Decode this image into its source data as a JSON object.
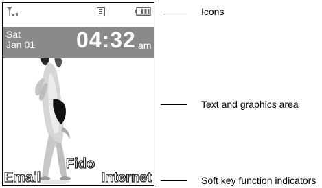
{
  "phone": {
    "status": {
      "icons": [
        "signal-icon",
        "message-icon",
        "battery-icon"
      ]
    },
    "date_line1": "Sat",
    "date_line2": "Jan 01",
    "time": "04:32",
    "ampm": "am",
    "wallpaper_name": "Fido",
    "soft_left": "Email",
    "soft_right": "Internet"
  },
  "callouts": [
    {
      "label": "Icons"
    },
    {
      "label": "Text and graphics area"
    },
    {
      "label": "Soft key function indicators"
    }
  ]
}
